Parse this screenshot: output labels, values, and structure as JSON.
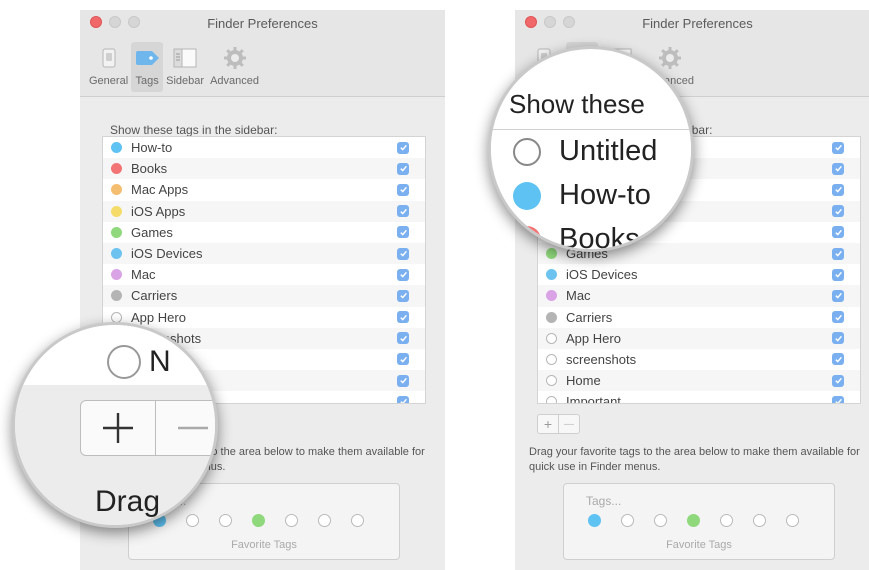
{
  "left_window": {
    "title": "Finder Preferences",
    "toolbar": [
      {
        "label": "General",
        "icon": "general-switch-icon",
        "active": false
      },
      {
        "label": "Tags",
        "icon": "tag-icon",
        "active": true
      },
      {
        "label": "Sidebar",
        "icon": "sidebar-icon",
        "active": false
      },
      {
        "label": "Advanced",
        "icon": "gear-icon",
        "active": false
      }
    ],
    "section_label": "Show these tags in the sidebar:",
    "tags": [
      {
        "name": "How-to",
        "color": "#5ec2f2",
        "checked": true
      },
      {
        "name": "Books",
        "color": "#f27474",
        "checked": true
      },
      {
        "name": "Mac Apps",
        "color": "#f5bd6f",
        "checked": true
      },
      {
        "name": "iOS Apps",
        "color": "#f5dc6a",
        "checked": true
      },
      {
        "name": "Games",
        "color": "#8fd87c",
        "checked": true
      },
      {
        "name": "iOS Devices",
        "color": "#6dc3ef",
        "checked": true
      },
      {
        "name": "Mac",
        "color": "#d9a3e6",
        "checked": true
      },
      {
        "name": "Carriers",
        "color": "#b4b4b4",
        "checked": true
      },
      {
        "name": "App Hero",
        "color": "",
        "checked": true
      },
      {
        "name": "screenshots",
        "color": "",
        "checked": true
      },
      {
        "name": "",
        "color": "",
        "checked": true
      },
      {
        "name": "",
        "color": "",
        "checked": true
      },
      {
        "name": "",
        "color": "",
        "checked": true
      }
    ],
    "drag_text": "Drag your favorite tags to the area below to make them available for quick use in Finder menus.",
    "favorites_placeholder": "Tags...",
    "favorites_label": "Favorite Tags",
    "favorite_dots": [
      "#5ec2f2",
      "",
      "",
      "#8fd87c",
      "",
      "",
      ""
    ]
  },
  "right_window": {
    "title": "Finder Preferences",
    "toolbar": [
      {
        "label": "General",
        "icon": "general-switch-icon",
        "active": false
      },
      {
        "label": "Tags",
        "icon": "tag-icon",
        "active": true
      },
      {
        "label": "Sidebar",
        "icon": "sidebar-icon",
        "active": false
      },
      {
        "label": "Advanced",
        "icon": "gear-icon",
        "active": false
      }
    ],
    "section_label": "Show these tags in the sidebar:",
    "tags": [
      {
        "name": "Untitled",
        "color": "",
        "checked": true
      },
      {
        "name": "How-to",
        "color": "#5ec2f2",
        "checked": true
      },
      {
        "name": "Books",
        "color": "#f27474",
        "checked": true
      },
      {
        "name": "Mac Apps",
        "color": "#f5bd6f",
        "checked": true
      },
      {
        "name": "iOS Apps",
        "color": "#f5dc6a",
        "checked": true
      },
      {
        "name": "Games",
        "color": "#8fd87c",
        "checked": true
      },
      {
        "name": "iOS Devices",
        "color": "#6dc3ef",
        "checked": true
      },
      {
        "name": "Mac",
        "color": "#d9a3e6",
        "checked": true
      },
      {
        "name": "Carriers",
        "color": "#b4b4b4",
        "checked": true
      },
      {
        "name": "App Hero",
        "color": "",
        "checked": true
      },
      {
        "name": "screenshots",
        "color": "",
        "checked": true
      },
      {
        "name": "Home",
        "color": "",
        "checked": true
      },
      {
        "name": "Important",
        "color": "",
        "checked": true
      }
    ],
    "drag_text": "Drag your favorite tags to the area below to make them available for quick use in Finder menus.",
    "favorites_placeholder": "Tags...",
    "favorites_label": "Favorite Tags",
    "favorite_dots": [
      "#5ec2f2",
      "",
      "",
      "#8fd87c",
      "",
      "",
      ""
    ]
  },
  "magnifier_left": {
    "partial_text": "N",
    "drag_fragment": "Drag"
  },
  "magnifier_right": {
    "heading_fragment": "Show these",
    "rows": [
      {
        "name": "Untitled",
        "color": ""
      },
      {
        "name": "How-to",
        "color": "#5ec2f2"
      },
      {
        "name": "Books",
        "color": "#f27474"
      }
    ]
  }
}
